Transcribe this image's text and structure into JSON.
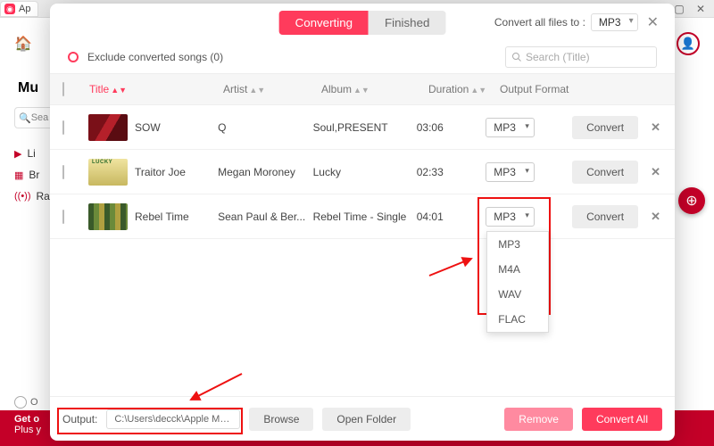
{
  "bg": {
    "tab_label": "Ap",
    "home_icon": "⌂",
    "logo_text": "Mu",
    "search_placeholder": "Sea",
    "nav": {
      "listen": "Li",
      "browse": "Br",
      "radio": "Ra"
    },
    "ob": "O",
    "promo_line1": "Get o",
    "promo_line2": "Plus y"
  },
  "modal": {
    "tabs": {
      "converting": "Converting",
      "finished": "Finished"
    },
    "convert_all_label": "Convert all files to :",
    "global_format": "MP3",
    "exclude_label": "Exclude converted songs (0)",
    "search_placeholder": "Search  (Title)",
    "columns": {
      "title": "Title",
      "artist": "Artist",
      "album": "Album",
      "duration": "Duration",
      "format": "Output Format"
    },
    "rows": [
      {
        "title": "SOW",
        "artist": "Q",
        "album": "Soul,PRESENT",
        "duration": "03:06",
        "format": "MP3",
        "convert": "Convert"
      },
      {
        "title": "Traitor Joe",
        "artist": "Megan Moroney",
        "album": "Lucky",
        "duration": "02:33",
        "format": "MP3",
        "convert": "Convert"
      },
      {
        "title": "Rebel Time",
        "artist": "Sean Paul & Ber...",
        "album": "Rebel Time - Single",
        "duration": "04:01",
        "format": "MP3",
        "convert": "Convert"
      }
    ],
    "dropdown_options": [
      "MP3",
      "M4A",
      "WAV",
      "FLAC"
    ],
    "footer": {
      "output_label": "Output:",
      "output_path": "C:\\Users\\decck\\Apple Music...",
      "browse": "Browse",
      "open_folder": "Open Folder",
      "remove": "Remove",
      "convert_all": "Convert All"
    }
  }
}
